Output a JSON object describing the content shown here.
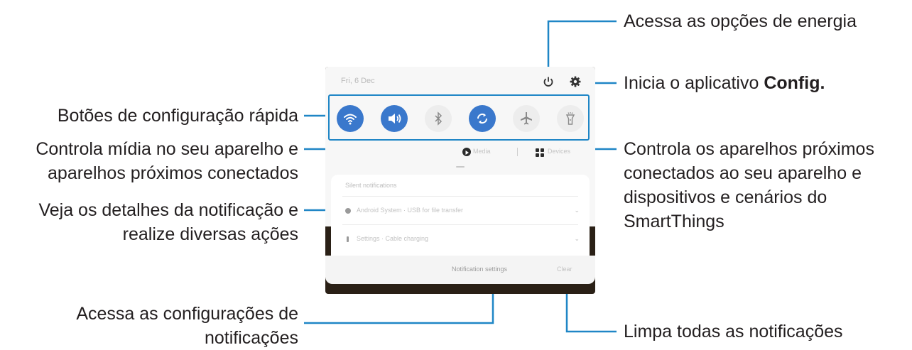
{
  "annotations": {
    "power_options": "Acessa as opções de energia",
    "settings_prefix": "Inicia o aplicativo ",
    "settings_bold": "Config.",
    "quick_settings": "Botões de configuração rápida",
    "media_line1": "Controla mídia no seu aparelho e",
    "media_line2": "aparelhos próximos conectados",
    "devices_line1": "Controla os aparelhos próximos",
    "devices_line2": "conectados ao seu aparelho e",
    "devices_line3": "dispositivos e cenários do",
    "devices_line4": "SmartThings",
    "notif_line1": "Veja os detalhes da notificação e",
    "notif_line2": "realize diversas ações",
    "notif_settings_line1": "Acessa as configurações de",
    "notif_settings_line2": "notificações",
    "clear_all": "Limpa todas as notificações"
  },
  "phone": {
    "date": "Fri, 6 Dec",
    "quick_settings": [
      {
        "name": "wifi-icon",
        "on": true
      },
      {
        "name": "sound-icon",
        "on": true
      },
      {
        "name": "bluetooth-icon",
        "on": false
      },
      {
        "name": "auto-rotate-icon",
        "on": true
      },
      {
        "name": "airplane-mode-icon",
        "on": false
      },
      {
        "name": "flashlight-icon",
        "on": false
      }
    ],
    "media_label": "Media",
    "devices_label": "Devices",
    "notifications_header": "Silent notifications",
    "notification_1": "Android System · USB for file transfer",
    "notification_2": "Settings · Cable charging",
    "notification_settings": "Notification settings",
    "clear": "Clear"
  },
  "colors": {
    "accent_line": "#1f86c6",
    "toggle_on": "#3a78cc",
    "text": "#231f20"
  }
}
